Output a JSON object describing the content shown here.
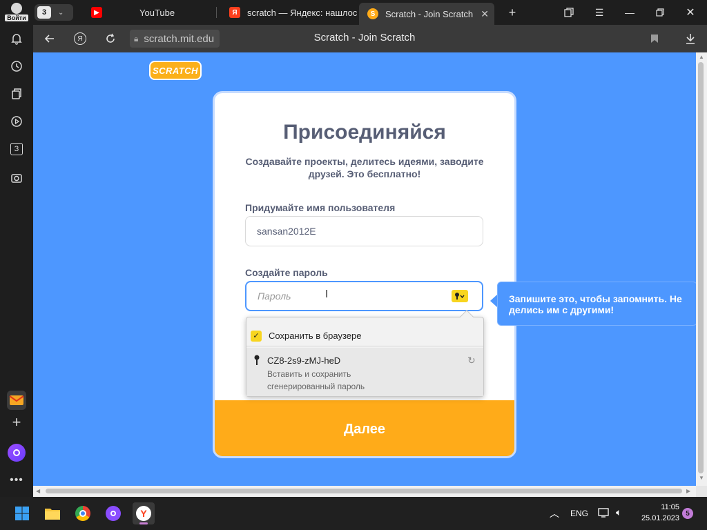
{
  "sidebar": {
    "login_label": "Войти",
    "items": [
      {
        "icon": "bell-icon"
      },
      {
        "icon": "history-icon"
      },
      {
        "icon": "collections-icon"
      },
      {
        "icon": "play-icon"
      },
      {
        "icon": "zen-icon",
        "label": "З"
      },
      {
        "icon": "screenshot-icon"
      }
    ],
    "bottom_items": [
      {
        "icon": "mail-icon"
      },
      {
        "icon": "add-icon"
      },
      {
        "icon": "alice-icon"
      },
      {
        "icon": "more-icon"
      }
    ]
  },
  "tabs": {
    "group_count": "3",
    "items": [
      {
        "label": "YouTube",
        "favicon": "youtube-icon",
        "active": false
      },
      {
        "label": "scratch — Яндекс: нашлось",
        "favicon": "yandex-icon",
        "active": false
      },
      {
        "label": "Scratch - Join Scratch",
        "favicon": "scratch-icon",
        "active": true
      }
    ]
  },
  "addressbar": {
    "url": "scratch.mit.edu",
    "title": "Scratch - Join Scratch"
  },
  "page": {
    "logo": "SCRATCH",
    "title": "Присоединяйся",
    "subtitle": "Создавайте проекты, делитесь идеями, заводите друзей. Это бесплатно!",
    "username_label": "Придумайте имя пользователя",
    "username_value": "sansan2012E",
    "password_label": "Создайте пароль",
    "password_placeholder": "Пароль",
    "next_button": "Далее",
    "tooltip": "Запишите это, чтобы запомнить. Не делись им с другими!"
  },
  "password_dropdown": {
    "save_label": "Сохранить в браузере",
    "save_checked": true,
    "generated_password": "CZ8-2s9-zMJ-heD",
    "generated_desc": "Вставить и сохранить сгенерированный пароль"
  },
  "taskbar": {
    "language": "ENG",
    "time": "11:05",
    "date": "25.01.2023",
    "notification_count": "5"
  },
  "colors": {
    "page_bg": "#4d97ff",
    "scratch_orange": "#ffab19",
    "text": "#575e75",
    "key_yellow": "#f8d51f"
  }
}
